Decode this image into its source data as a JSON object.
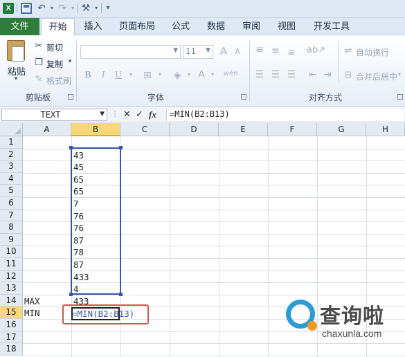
{
  "app": {
    "logo_letter": "X",
    "accent": "#2f7d3b",
    "selection_color": "#3556a8",
    "callout_color": "#d9534f"
  },
  "quick_access": {
    "save_icon": "save-icon",
    "undo_icon": "undo-icon",
    "redo_icon": "redo-icon",
    "custom_icon": "tools-icon"
  },
  "tabs": [
    {
      "label": "文件"
    },
    {
      "label": "开始"
    },
    {
      "label": "插入"
    },
    {
      "label": "页面布局"
    },
    {
      "label": "公式"
    },
    {
      "label": "数据"
    },
    {
      "label": "审阅"
    },
    {
      "label": "视图"
    },
    {
      "label": "开发工具"
    }
  ],
  "ribbon": {
    "clipboard": {
      "paste": "粘贴",
      "cut": "剪切",
      "copy": "复制",
      "format_painter": "格式刷",
      "group_label": "剪贴板"
    },
    "font": {
      "font_size": "11",
      "grow": "A",
      "shrink": "A",
      "bold": "B",
      "italic": "I",
      "underline": "U",
      "font_color": "A",
      "phonetic": "wén",
      "group_label": "字体"
    },
    "alignment": {
      "wrap_text": "自动换行",
      "merge_center": "合并后居中",
      "group_label": "对齐方式"
    }
  },
  "formula_bar": {
    "name_box": "TEXT",
    "cancel_icon": "✕",
    "enter_icon": "✓",
    "fx": "fx",
    "formula": "=MIN(B2:B13)"
  },
  "sheet": {
    "columns": [
      "A",
      "B",
      "C",
      "D",
      "E",
      "F",
      "G",
      "H"
    ],
    "rows": [
      "1",
      "2",
      "3",
      "4",
      "5",
      "6",
      "7",
      "8",
      "9",
      "10",
      "11",
      "12",
      "13",
      "14",
      "15",
      "16",
      "17",
      "18"
    ],
    "b_values": [
      "43",
      "45",
      "65",
      "65",
      "7",
      "76",
      "76",
      "87",
      "78",
      "87",
      "433",
      "4"
    ],
    "a14": "MAX",
    "b14": "433",
    "a15": "MIN",
    "b15_editing": "=MIN(B2:B13)",
    "active_column": "B",
    "active_row": "15"
  },
  "watermark": {
    "name": "查询啦",
    "url": "chaxunla.com"
  }
}
